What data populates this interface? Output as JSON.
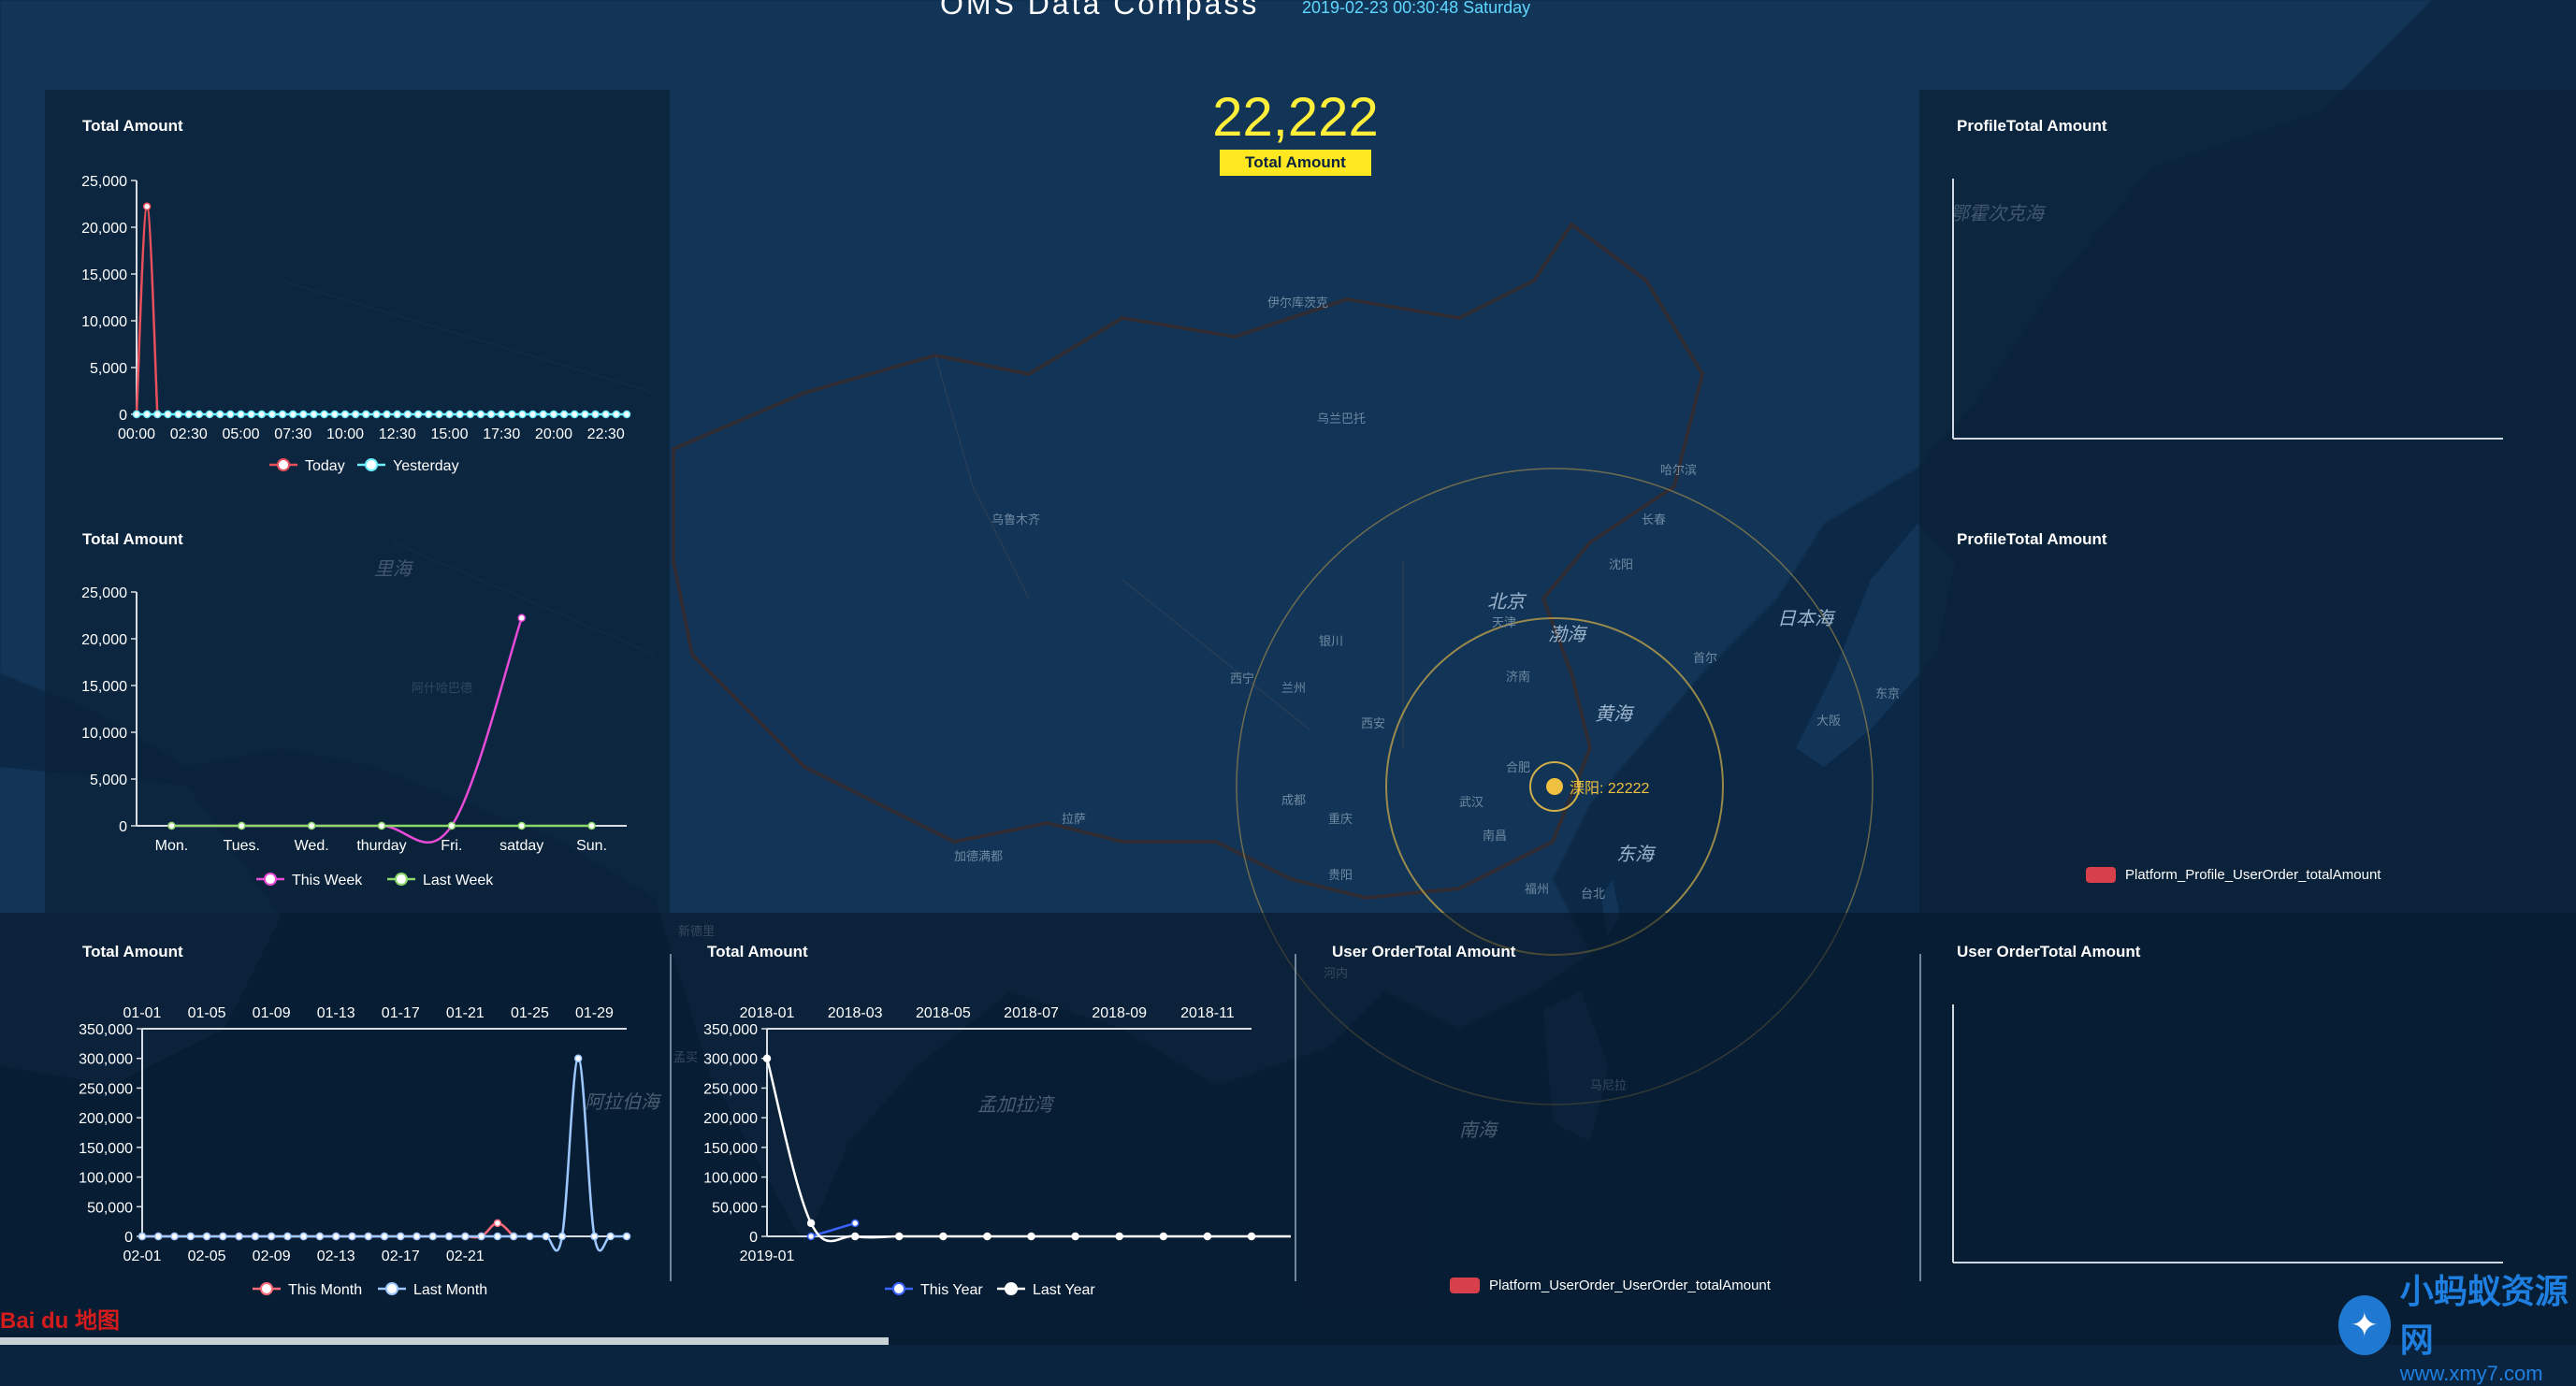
{
  "header": {
    "title": "OMS Data Compass",
    "datetime": "2019-02-23 00:30:48 Saturday"
  },
  "summary": {
    "value": "22,222",
    "label": "Total Amount"
  },
  "map": {
    "marker_label": "溧阳: 22222",
    "marker_color": "#f0c040",
    "places": [
      {
        "name": "北京",
        "size": "big"
      },
      {
        "name": "渤海",
        "size": "big"
      },
      {
        "name": "黄海",
        "size": "big"
      },
      {
        "name": "东海",
        "size": "big"
      },
      {
        "name": "日本海",
        "size": "big"
      },
      {
        "name": "里海",
        "size": "big"
      },
      {
        "name": "孟加拉湾",
        "size": "big"
      },
      {
        "name": "阿拉伯海",
        "size": "big"
      },
      {
        "name": "南海",
        "size": "big"
      },
      {
        "name": "鄂霍次克海",
        "size": "big"
      },
      {
        "name": "乌鲁木齐",
        "size": "small"
      },
      {
        "name": "拉萨",
        "size": "small"
      },
      {
        "name": "西宁",
        "size": "small"
      },
      {
        "name": "兰州",
        "size": "small"
      },
      {
        "name": "银川",
        "size": "small"
      },
      {
        "name": "西安",
        "size": "small"
      },
      {
        "name": "成都",
        "size": "small"
      },
      {
        "name": "重庆",
        "size": "small"
      },
      {
        "name": "贵阳",
        "size": "small"
      },
      {
        "name": "武汉",
        "size": "small"
      },
      {
        "name": "合肥",
        "size": "small"
      },
      {
        "name": "南昌",
        "size": "small"
      },
      {
        "name": "福州",
        "size": "small"
      },
      {
        "name": "台北",
        "size": "small"
      },
      {
        "name": "济南",
        "size": "small"
      },
      {
        "name": "天津",
        "size": "small"
      },
      {
        "name": "沈阳",
        "size": "small"
      },
      {
        "name": "长春",
        "size": "small"
      },
      {
        "name": "哈尔滨",
        "size": "small"
      },
      {
        "name": "首尔",
        "size": "small"
      },
      {
        "name": "大阪",
        "size": "small"
      },
      {
        "name": "东京",
        "size": "small"
      },
      {
        "name": "乌兰巴托",
        "size": "small"
      },
      {
        "name": "伊尔库茨克",
        "size": "small"
      },
      {
        "name": "新德里",
        "size": "small"
      },
      {
        "name": "加德满都",
        "size": "small"
      },
      {
        "name": "河内",
        "size": "small"
      },
      {
        "name": "马尼拉",
        "size": "small"
      },
      {
        "name": "孟买",
        "size": "small"
      },
      {
        "name": "阿什哈巴德",
        "size": "small"
      }
    ]
  },
  "panels": {
    "left_top": {
      "title": "Total Amount",
      "legend": [
        "Today",
        "Yesterday"
      ]
    },
    "left_mid": {
      "title": "Total Amount",
      "legend": [
        "This Week",
        "Last Week"
      ]
    },
    "bottom_1": {
      "title": "Total Amount",
      "legend": [
        "This Month",
        "Last Month"
      ]
    },
    "bottom_2": {
      "title": "Total Amount",
      "legend": [
        "This Year",
        "Last Year"
      ]
    },
    "bottom_3": {
      "title": "User OrderTotal Amount",
      "legend": "Platform_UserOrder_UserOrder_totalAmount"
    },
    "bottom_4": {
      "title": "User OrderTotal Amount"
    },
    "right_top": {
      "title": "ProfileTotal Amount"
    },
    "right_mid": {
      "title": "ProfileTotal Amount",
      "legend": "Platform_Profile_UserOrder_totalAmount"
    }
  },
  "colors": {
    "today": "#e8505b",
    "yesterday": "#6ff0ff",
    "this_week": "#e84bd8",
    "last_week": "#8bd86b",
    "this_month": "#ff6a7a",
    "last_month": "#9cc8ff",
    "this_year": "#3a64ff",
    "last_year": "#ffffff",
    "legend_swatch": "#d7404a"
  },
  "footer": {
    "logo": "Bai du 地图",
    "watermark_title": "小蚂蚁资源网",
    "watermark_url": "www.xmy7.com"
  },
  "chart_data": [
    {
      "id": "left_top",
      "type": "line",
      "title": "Total Amount",
      "categories": [
        "00:00",
        "00:30",
        "01:00",
        "01:30",
        "02:00",
        "02:30",
        "03:00",
        "03:30",
        "04:00",
        "04:30",
        "05:00",
        "05:30",
        "06:00",
        "06:30",
        "07:00",
        "07:30",
        "08:00",
        "08:30",
        "09:00",
        "09:30",
        "10:00",
        "10:30",
        "11:00",
        "11:30",
        "12:00",
        "12:30",
        "13:00",
        "13:30",
        "14:00",
        "14:30",
        "15:00",
        "15:30",
        "16:00",
        "16:30",
        "17:00",
        "17:30",
        "18:00",
        "18:30",
        "19:00",
        "19:30",
        "20:00",
        "20:30",
        "21:00",
        "21:30",
        "22:00",
        "22:30",
        "23:00",
        "23:30"
      ],
      "tick_labels": [
        "00:00",
        "02:30",
        "05:00",
        "07:30",
        "10:00",
        "12:30",
        "15:00",
        "17:30",
        "20:00",
        "22:30"
      ],
      "y_ticks": [
        "0",
        "5,000",
        "10,000",
        "15,000",
        "20,000",
        "25,000"
      ],
      "ylim": [
        0,
        25000
      ],
      "series": [
        {
          "name": "Today",
          "values": [
            0,
            22222,
            0
          ]
        },
        {
          "name": "Yesterday",
          "values": [
            0,
            0,
            0,
            0,
            0,
            0,
            0,
            0,
            0,
            0,
            0,
            0,
            0,
            0,
            0,
            0,
            0,
            0,
            0,
            0,
            0,
            0,
            0,
            0,
            0,
            0,
            0,
            0,
            0,
            0,
            0,
            0,
            0,
            0,
            0,
            0,
            0,
            0,
            0,
            0,
            0,
            0,
            0,
            0,
            0,
            0,
            0,
            0
          ]
        }
      ]
    },
    {
      "id": "left_mid",
      "type": "line",
      "title": "Total Amount",
      "categories": [
        "Mon.",
        "Tues.",
        "Wed.",
        "thurday",
        "Fri.",
        "satday",
        "Sun."
      ],
      "y_ticks": [
        "0",
        "5,000",
        "10,000",
        "15,000",
        "20,000",
        "25,000"
      ],
      "ylim": [
        0,
        25000
      ],
      "series": [
        {
          "name": "This Week",
          "values": [
            0,
            0,
            0,
            0,
            0,
            22222
          ]
        },
        {
          "name": "Last Week",
          "values": [
            0,
            0,
            0,
            0,
            0,
            0,
            0
          ]
        }
      ]
    },
    {
      "id": "bottom_1",
      "type": "line",
      "title": "Total Amount",
      "categories": [
        "01-01",
        "01-02",
        "01-03",
        "01-04",
        "01-05",
        "01-06",
        "01-07",
        "01-08",
        "01-09",
        "01-10",
        "01-11",
        "01-12",
        "01-13",
        "01-14",
        "01-15",
        "01-16",
        "01-17",
        "01-18",
        "01-19",
        "01-20",
        "01-21",
        "01-22",
        "01-23",
        "01-24",
        "01-25",
        "01-26",
        "01-27",
        "01-28",
        "01-29",
        "01-30",
        "01-31"
      ],
      "top_tick_labels": [
        "01-01",
        "01-05",
        "01-09",
        "01-13",
        "01-17",
        "01-21",
        "01-25",
        "01-29"
      ],
      "bottom_tick_labels": [
        "02-01",
        "02-05",
        "02-09",
        "02-13",
        "02-17",
        "02-21"
      ],
      "y_ticks": [
        "0",
        "50,000",
        "100,000",
        "150,000",
        "200,000",
        "250,000",
        "300,000",
        "350,000"
      ],
      "ylim": [
        0,
        350000
      ],
      "series": [
        {
          "name": "This Month",
          "values": [
            0,
            0,
            0,
            0,
            0,
            0,
            0,
            0,
            0,
            0,
            0,
            0,
            0,
            0,
            0,
            0,
            0,
            0,
            0,
            0,
            0,
            0,
            22222,
            0
          ]
        },
        {
          "name": "Last Month",
          "values": [
            0,
            0,
            0,
            0,
            0,
            0,
            0,
            0,
            0,
            0,
            0,
            0,
            0,
            0,
            0,
            0,
            0,
            0,
            0,
            0,
            0,
            0,
            0,
            0,
            0,
            0,
            0,
            300000,
            0,
            0,
            0
          ]
        }
      ]
    },
    {
      "id": "bottom_2",
      "type": "line",
      "title": "Total Amount",
      "categories": [
        "2018-01",
        "2018-02",
        "2018-03",
        "2018-04",
        "2018-05",
        "2018-06",
        "2018-07",
        "2018-08",
        "2018-09",
        "2018-10",
        "2018-11",
        "2018-12"
      ],
      "top_tick_labels": [
        "2018-01",
        "2018-03",
        "2018-05",
        "2018-07",
        "2018-09",
        "2018-11"
      ],
      "bottom_tick_labels": [
        "2019-01"
      ],
      "y_ticks": [
        "0",
        "50,000",
        "100,000",
        "150,000",
        "200,000",
        "250,000",
        "300,000",
        "350,000"
      ],
      "ylim": [
        0,
        350000
      ],
      "series": [
        {
          "name": "This Year",
          "values": [
            0,
            22222
          ]
        },
        {
          "name": "Last Year",
          "values": [
            300000,
            22222,
            0,
            0,
            0,
            0,
            0,
            0,
            0,
            0,
            0,
            0,
            0
          ]
        }
      ]
    }
  ]
}
